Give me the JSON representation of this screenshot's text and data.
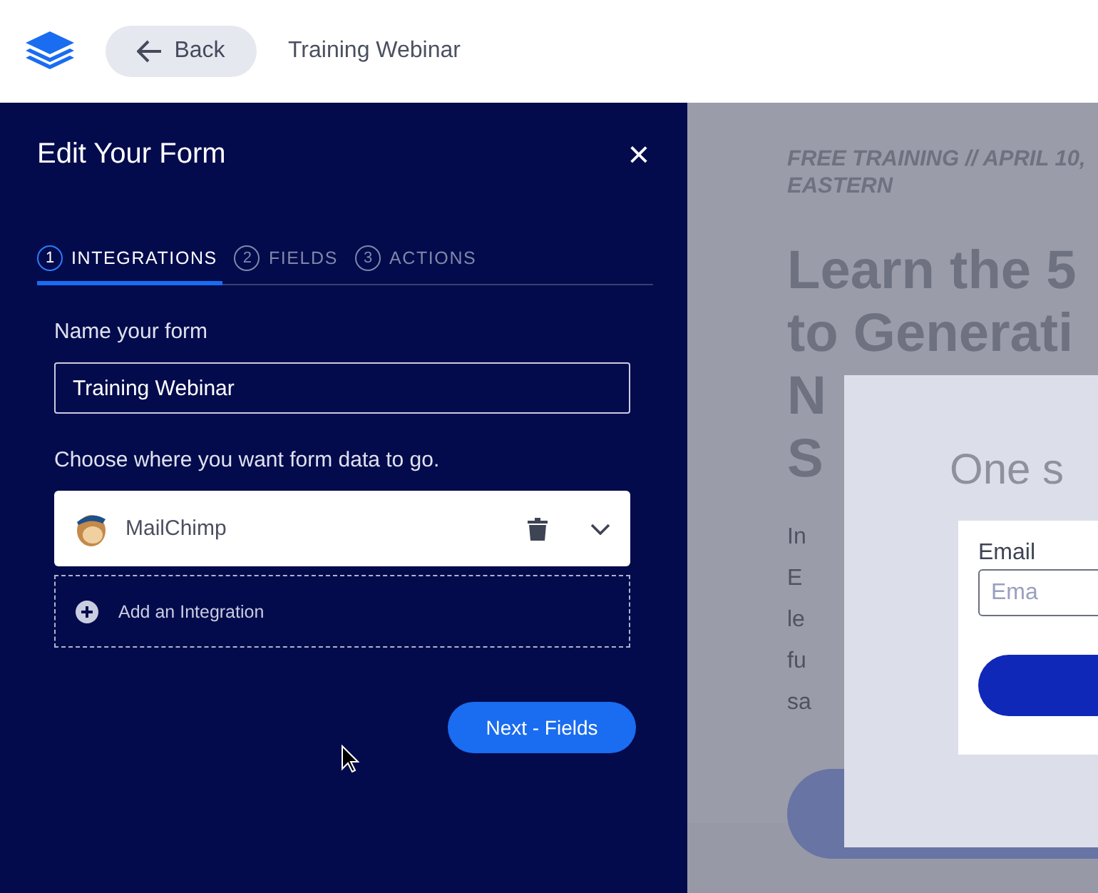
{
  "header": {
    "back_label": "Back",
    "title": "Training Webinar"
  },
  "editor": {
    "title": "Edit Your Form",
    "close": "×",
    "steps": [
      {
        "number": "1",
        "label": "INTEGRATIONS",
        "selected": true
      },
      {
        "number": "2",
        "label": "FIELDS",
        "selected": false
      },
      {
        "number": "3",
        "label": "ACTIONS",
        "selected": false
      }
    ],
    "name_label": "Name your form",
    "name_value": "Training Webinar",
    "destination_label": "Choose where you want form data to go.",
    "integrations": [
      {
        "name": "MailChimp"
      }
    ],
    "add_integration": "Add an Integration",
    "next_button": "Next - Fields"
  },
  "preview": {
    "eyebrow": [
      "FREE TRAINING // APRIL 10,",
      "EASTERN"
    ],
    "headline": [
      "Learn the 5",
      "to Generati",
      "N",
      "S"
    ],
    "body": [
      "In",
      "E",
      "le",
      "fu",
      "sa"
    ],
    "popup": {
      "title": "One s",
      "email_label": "Email",
      "email_placeholder": "Ema"
    }
  }
}
